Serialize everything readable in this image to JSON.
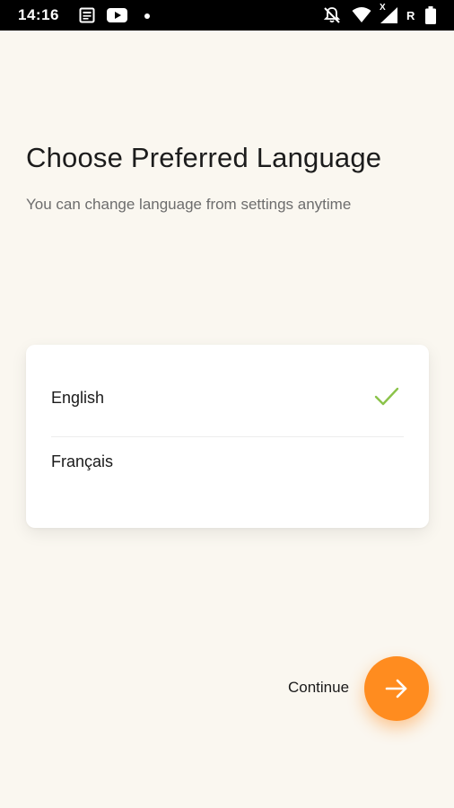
{
  "status_bar": {
    "time": "14:16",
    "network_label": "R",
    "no_data_label": "X",
    "icons": [
      "news-icon",
      "youtube-icon",
      "notification-dot-icon",
      "notifications-off-icon",
      "wifi-icon",
      "signal-icon",
      "battery-icon"
    ]
  },
  "page": {
    "title": "Choose Preferred Language",
    "subtitle": "You can change language from settings anytime"
  },
  "languages": [
    {
      "label": "English",
      "selected": true
    },
    {
      "label": "Français",
      "selected": false
    }
  ],
  "continue": {
    "label": "Continue",
    "icon": "arrow-right-icon"
  },
  "colors": {
    "background": "#faf7f0",
    "accent": "#ff8c1f",
    "check": "#8bc34a"
  }
}
